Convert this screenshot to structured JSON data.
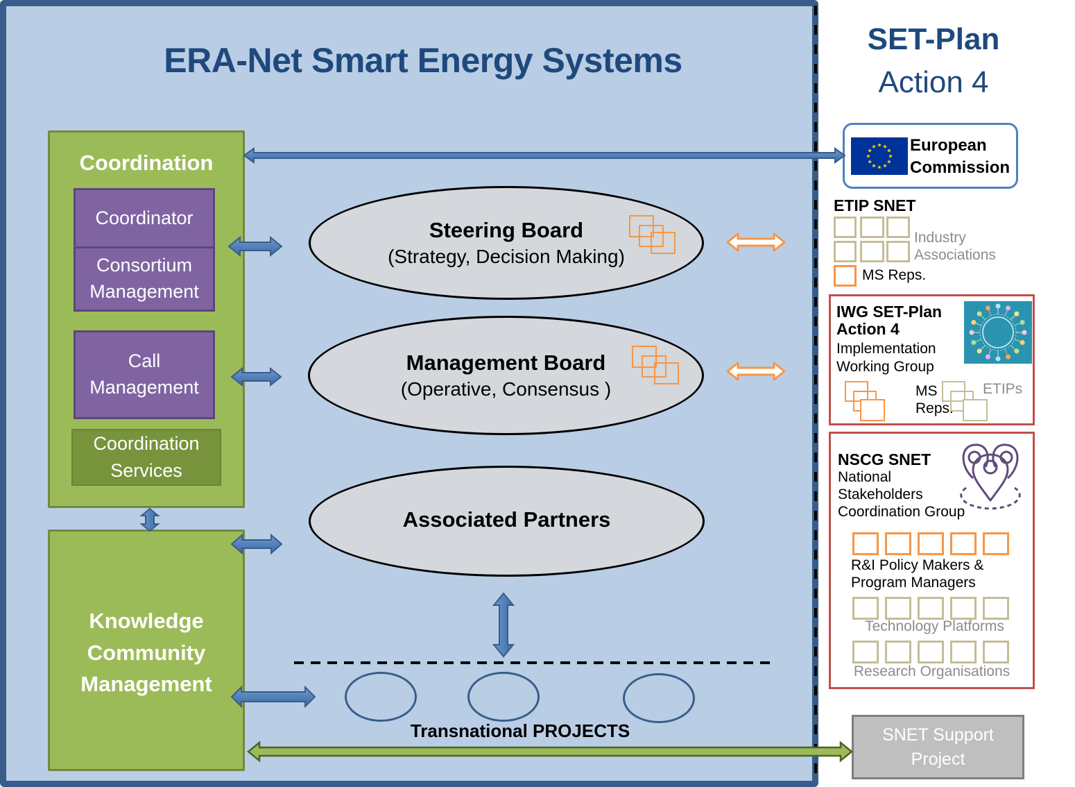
{
  "main": {
    "title": "ERA-Net Smart Energy Systems",
    "coordination": {
      "title": "Coordination",
      "coordinator": "Coordinator",
      "consortium_line1": "Consortium",
      "consortium_line2": "Management",
      "call_line1": "Call",
      "call_line2": "Management",
      "services_line1": "Coordination",
      "services_line2": "Services"
    },
    "knowledge": {
      "line1": "Knowledge",
      "line2": "Community",
      "line3": "Management"
    },
    "steering_board": {
      "title": "Steering Board",
      "subtitle": "(Strategy, Decision Making)"
    },
    "management_board": {
      "title": "Management Board",
      "subtitle": "(Operative, Consensus )"
    },
    "associated_partners": {
      "title": "Associated Partners"
    },
    "projects": {
      "label": "Transnational PROJECTS",
      "count": 3
    }
  },
  "set_plan": {
    "title_line1": "SET-Plan",
    "title_line2": "Action 4",
    "european_commission": {
      "line1": "European",
      "line2": "Commission",
      "icon": "eu-flag-icon"
    },
    "etip_snet": {
      "title": "ETIP SNET",
      "industry_line1": "Industry",
      "industry_line2": "Associations",
      "ms_reps": "MS Reps."
    },
    "iwg": {
      "title_line1": "IWG SET-Plan",
      "title_line2": "Action 4",
      "sub_line1": "Implementation",
      "sub_line2": "Working Group",
      "ms_line1": "MS",
      "ms_line2": "Reps.",
      "etips": "ETIPs"
    },
    "nscg": {
      "title": "NSCG SNET",
      "sub_line1": "National",
      "sub_line2": "Stakeholders",
      "sub_line3": "Coordination Group",
      "policy_line1": "R&I Policy Makers &",
      "policy_line2": "Program Managers",
      "tech_platforms": "Technology Platforms",
      "research_orgs": "Research Organisations"
    },
    "snet_support": {
      "line1": "SNET Support",
      "line2": "Project"
    }
  },
  "colors": {
    "frame": "#385d8a",
    "frame_fill": "#b9cde5",
    "title_blue": "#1f497d",
    "green": "#9bbb59",
    "dark_green": "#77933c",
    "purple": "#8064a2",
    "orange": "#f79646",
    "tan": "#c4bd97",
    "red_border": "#c0504d",
    "grey_box": "#bfbfbf",
    "arrow_blue": "#4f81bd"
  }
}
